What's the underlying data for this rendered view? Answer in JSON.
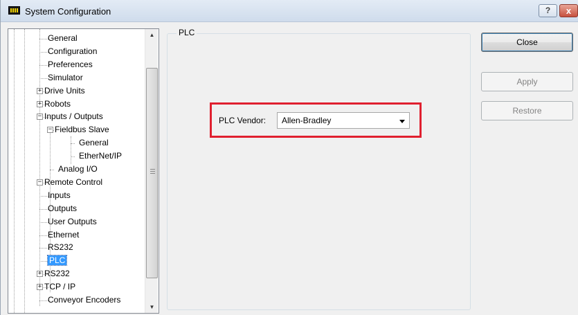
{
  "window": {
    "title": "System Configuration",
    "help_label": "?",
    "close_label": "x"
  },
  "tree": {
    "items": [
      {
        "label": "General",
        "level": 2,
        "expander": ""
      },
      {
        "label": "Configuration",
        "level": 2,
        "expander": ""
      },
      {
        "label": "Preferences",
        "level": 2,
        "expander": ""
      },
      {
        "label": "Simulator",
        "level": 2,
        "expander": ""
      },
      {
        "label": "Drive Units",
        "level": 1,
        "expander": "+"
      },
      {
        "label": "Robots",
        "level": 1,
        "expander": "+"
      },
      {
        "label": "Inputs / Outputs",
        "level": 1,
        "expander": "-"
      },
      {
        "label": "Fieldbus Slave",
        "level": 2,
        "expander": "-"
      },
      {
        "label": "General",
        "level": 3,
        "expander": ""
      },
      {
        "label": "EtherNet/IP",
        "level": 3,
        "expander": ""
      },
      {
        "label": "Analog I/O",
        "level": 2,
        "expander": ""
      },
      {
        "label": "Remote Control",
        "level": 1,
        "expander": "-"
      },
      {
        "label": "Inputs",
        "level": 2,
        "expander": ""
      },
      {
        "label": "Outputs",
        "level": 2,
        "expander": ""
      },
      {
        "label": "User Outputs",
        "level": 2,
        "expander": ""
      },
      {
        "label": "Ethernet",
        "level": 2,
        "expander": ""
      },
      {
        "label": "RS232",
        "level": 2,
        "expander": ""
      },
      {
        "label": "PLC",
        "level": 2,
        "expander": "",
        "selected": true
      },
      {
        "label": "RS232",
        "level": 1,
        "expander": "+"
      },
      {
        "label": "TCP / IP",
        "level": 1,
        "expander": "+"
      },
      {
        "label": "Conveyor Encoders",
        "level": 2,
        "expander": ""
      }
    ]
  },
  "panel": {
    "group_title": "PLC",
    "vendor_label": "PLC Vendor:",
    "vendor_value": "Allen-Bradley"
  },
  "buttons": {
    "close": "Close",
    "apply": "Apply",
    "restore": "Restore"
  },
  "colors": {
    "highlight": "#e0202f",
    "selection": "#3399ff"
  }
}
